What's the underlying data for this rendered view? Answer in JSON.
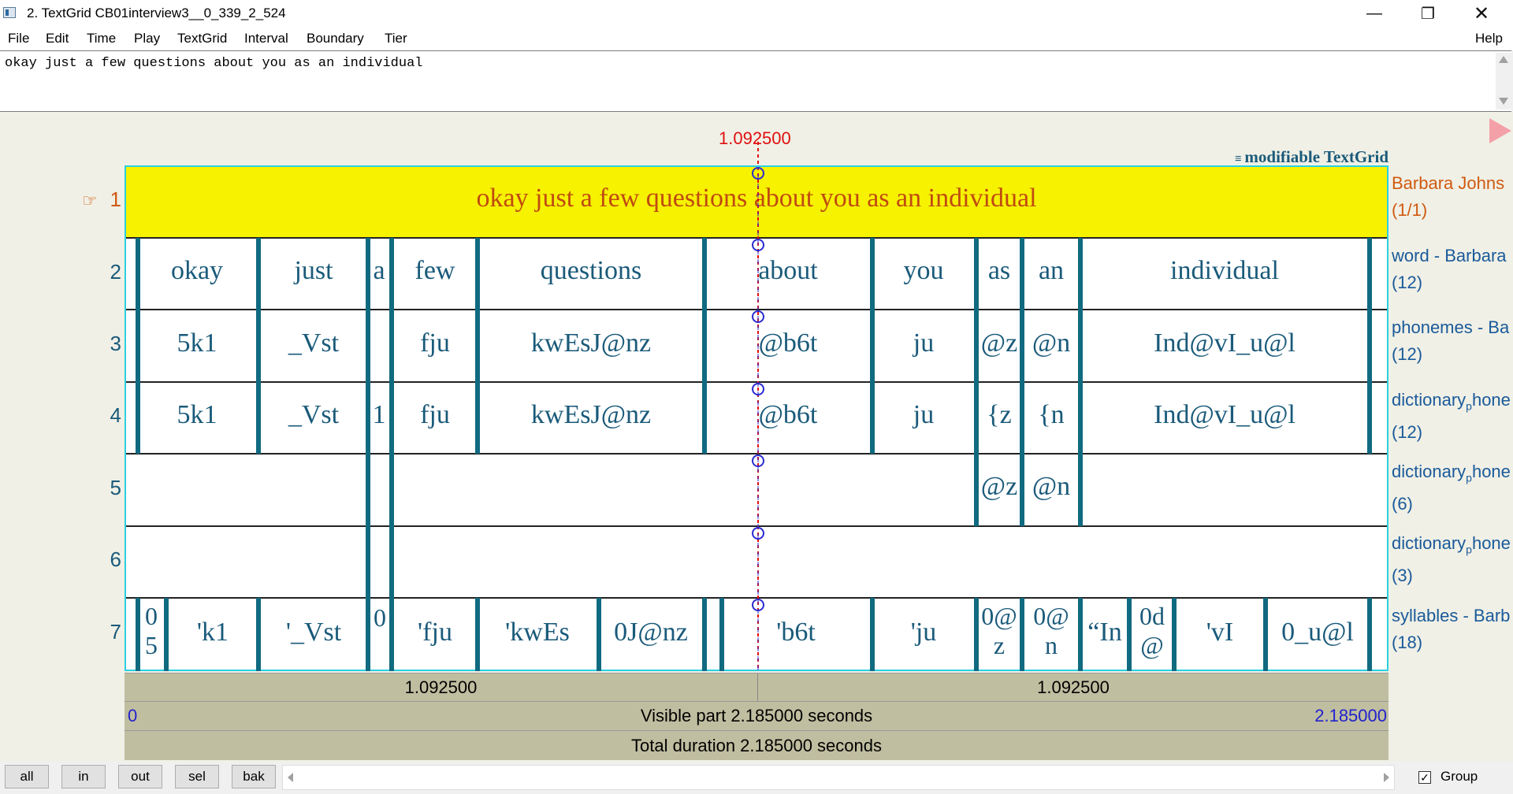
{
  "window": {
    "title": "2. TextGrid CB01interview3__0_339_2_524",
    "controls": [
      "minimize",
      "maximize",
      "close"
    ]
  },
  "menu": {
    "items": [
      "File",
      "Edit",
      "Time",
      "Play",
      "TextGrid",
      "Interval",
      "Boundary",
      "Tier"
    ],
    "help": "Help"
  },
  "text_field": {
    "value": "okay just a few questions about you as an individual"
  },
  "editor": {
    "cursor_time": "1.092500",
    "grid_label": "modifiable TextGrid",
    "tiers": [
      {
        "num": "1",
        "name": "Barbara Johns",
        "count": "(1/1)",
        "active": true,
        "intervals": [
          "okay just a few questions about you as an individual"
        ]
      },
      {
        "num": "2",
        "name": "word - Barbara",
        "count": "(12)",
        "intervals": [
          "okay",
          "just",
          "a",
          "few",
          "questions",
          "about",
          "you",
          "as",
          "an",
          "individual"
        ]
      },
      {
        "num": "3",
        "name": "phonemes - Ba",
        "count": "(12)",
        "intervals": [
          "5k1",
          "_Vst",
          "fju",
          "kwEsJ@nz",
          "@b6t",
          "ju",
          "@z",
          "@n",
          "Ind@vI_u@l"
        ]
      },
      {
        "num": "4",
        "name_main": "dictionary",
        "name_sub": "p",
        "name_rest": "hone",
        "count": "(12)",
        "intervals": [
          "5k1",
          "_Vst",
          "1",
          "fju",
          "kwEsJ@nz",
          "@b6t",
          "ju",
          "{z",
          "{n",
          "Ind@vI_u@l"
        ]
      },
      {
        "num": "5",
        "name_main": "dictionary",
        "name_sub": "p",
        "name_rest": "hone",
        "count": "(6)",
        "intervals": [
          "@z",
          "@n"
        ]
      },
      {
        "num": "6",
        "name_main": "dictionary",
        "name_sub": "p",
        "name_rest": "hone",
        "count": "(3)",
        "intervals": []
      },
      {
        "num": "7",
        "name": "syllables - Barb",
        "count": "(18)",
        "intervals": [
          "0",
          "5",
          "'k1",
          "'_Vst",
          "0",
          "'fju",
          "'kwEs",
          "0J@nz",
          "'b6t",
          "'ju",
          "0@",
          "z",
          "0@",
          "n",
          "“In",
          "0d",
          "@",
          "'vI",
          "0_u@l"
        ]
      }
    ],
    "left_duration": "1.092500",
    "right_duration": "1.092500",
    "visible_start": "0",
    "visible_label": "Visible part 2.185000 seconds",
    "visible_end": "2.185000",
    "total_label": "Total duration 2.185000 seconds"
  },
  "bottom": {
    "buttons": [
      "all",
      "in",
      "out",
      "sel",
      "bak"
    ],
    "group_label": "Group",
    "group_checked": true
  }
}
